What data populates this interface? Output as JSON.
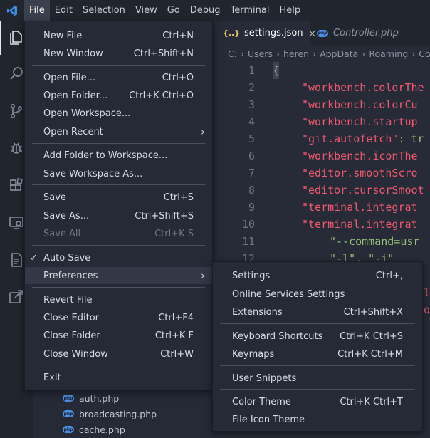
{
  "menubar": {
    "items": [
      "File",
      "Edit",
      "Selection",
      "View",
      "Go",
      "Debug",
      "Terminal",
      "Help"
    ],
    "active": "File",
    "icon": "vscode-logo-icon"
  },
  "activitybar": {
    "icons": [
      "explorer-icon",
      "search-icon",
      "source-control-icon",
      "debug-icon",
      "extensions-icon",
      "remote-explorer-icon",
      "notebook-icon",
      "deploy-icon"
    ]
  },
  "sidebar": {
    "files": [
      "auth.php",
      "broadcasting.php",
      "cache.php"
    ]
  },
  "editor": {
    "tabs": [
      {
        "label": "settings.json",
        "icon": "{..}",
        "close": "×"
      },
      {
        "label": "Controller.php",
        "icon": "php"
      }
    ],
    "breadcrumb": [
      "C:",
      "Users",
      "heren",
      "AppData",
      "Roaming",
      "Code"
    ],
    "lines": [
      {
        "n": "1",
        "text": "{"
      },
      {
        "n": "2",
        "text": "\"workbench.colorThe"
      },
      {
        "n": "3",
        "text": "\"workbench.colorCu"
      },
      {
        "n": "4",
        "text": "\"workbench.startup"
      },
      {
        "n": "5",
        "text": "\"git.autofetch\"",
        "suffix": ": tr"
      },
      {
        "n": "6",
        "text": "\"workbench.iconThe"
      },
      {
        "n": "7",
        "text": "\"editor.smoothScro"
      },
      {
        "n": "8",
        "text": "\"editor.cursorSmoot"
      },
      {
        "n": "9",
        "text": "\"terminal.integrat"
      },
      {
        "n": "10",
        "text": "\"terminal.integrat"
      },
      {
        "n": "11",
        "text": "\"--command=usr"
      },
      {
        "n": "12",
        "text": "\"-l\", \"-i\""
      }
    ],
    "partial_lines": [
      "l",
      "o"
    ]
  },
  "file_menu": {
    "groups": [
      [
        {
          "label": "New File",
          "key": "Ctrl+N"
        },
        {
          "label": "New Window",
          "key": "Ctrl+Shift+N"
        }
      ],
      [
        {
          "label": "Open File...",
          "key": "Ctrl+O"
        },
        {
          "label": "Open Folder...",
          "key": "Ctrl+K Ctrl+O"
        },
        {
          "label": "Open Workspace...",
          "key": ""
        },
        {
          "label": "Open Recent",
          "key": "",
          "submenu": true
        }
      ],
      [
        {
          "label": "Add Folder to Workspace...",
          "key": ""
        },
        {
          "label": "Save Workspace As...",
          "key": ""
        }
      ],
      [
        {
          "label": "Save",
          "key": "Ctrl+S"
        },
        {
          "label": "Save As...",
          "key": "Ctrl+Shift+S"
        },
        {
          "label": "Save All",
          "key": "Ctrl+K S",
          "disabled": true
        }
      ],
      [
        {
          "label": "Auto Save",
          "key": "",
          "checked": true
        },
        {
          "label": "Preferences",
          "key": "",
          "submenu": true,
          "highlighted": true
        }
      ],
      [
        {
          "label": "Revert File",
          "key": ""
        },
        {
          "label": "Close Editor",
          "key": "Ctrl+F4"
        },
        {
          "label": "Close Folder",
          "key": "Ctrl+K F"
        },
        {
          "label": "Close Window",
          "key": "Ctrl+W"
        }
      ],
      [
        {
          "label": "Exit",
          "key": ""
        }
      ]
    ]
  },
  "preferences_menu": {
    "groups": [
      [
        {
          "label": "Settings",
          "key": "Ctrl+,"
        },
        {
          "label": "Online Services Settings",
          "key": ""
        },
        {
          "label": "Extensions",
          "key": "Ctrl+Shift+X"
        }
      ],
      [
        {
          "label": "Keyboard Shortcuts",
          "key": "Ctrl+K Ctrl+S"
        },
        {
          "label": "Keymaps",
          "key": "Ctrl+K Ctrl+M"
        }
      ],
      [
        {
          "label": "User Snippets",
          "key": ""
        }
      ],
      [
        {
          "label": "Color Theme",
          "key": "Ctrl+K Ctrl+T"
        },
        {
          "label": "File Icon Theme",
          "key": ""
        }
      ]
    ]
  },
  "colors": {
    "accent": "#3d8fe8",
    "string_key": "#ef596f",
    "string_value": "#98c379",
    "background": "#252a36"
  }
}
